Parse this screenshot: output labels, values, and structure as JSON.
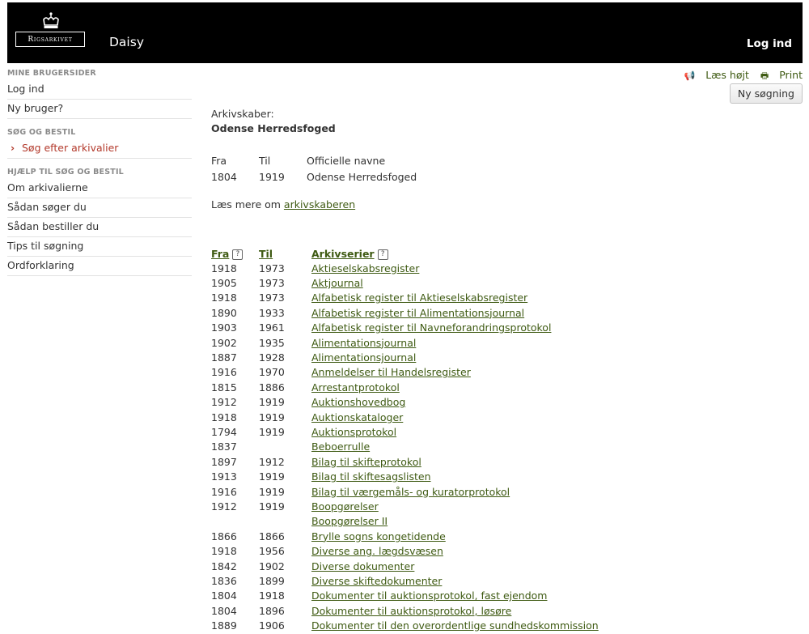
{
  "header": {
    "logo_text": "Rigsarkivet",
    "app_name": "Daisy",
    "login": "Log ind"
  },
  "sidebar": {
    "section1": "MINE BRUGERSIDER",
    "login": "Log ind",
    "new_user": "Ny bruger?",
    "section2": "SØG OG BESTIL",
    "search_active": "Søg efter arkivalier",
    "section3": "HJÆLP TIL SØG OG BESTIL",
    "help_items": [
      "Om arkivalierne",
      "Sådan søger du",
      "Sådan bestiller du",
      "Tips til søgning",
      "Ordforklaring"
    ]
  },
  "toolbar": {
    "read_aloud": "Læs højt",
    "print": "Print",
    "new_search": "Ny søgning"
  },
  "creator": {
    "label": "Arkivskaber:",
    "name": "Odense Herredsfoged",
    "col_from": "Fra",
    "col_to": "Til",
    "col_names": "Officielle navne",
    "from": "1804",
    "to": "1919",
    "official_name": "Odense Herredsfoged",
    "read_more_prefix": "Læs mere om ",
    "read_more_link": "arkivskaberen"
  },
  "series": {
    "col_from": "Fra",
    "col_to": "Til",
    "col_series": "Arkivserier",
    "help": "?",
    "rows": [
      {
        "from": "1918",
        "to": "1973",
        "name": "Aktieselskabsregister"
      },
      {
        "from": "1905",
        "to": "1973",
        "name": "Aktjournal"
      },
      {
        "from": "1918",
        "to": "1973",
        "name": "Alfabetisk register til Aktieselskabsregister"
      },
      {
        "from": "1890",
        "to": "1933",
        "name": "Alfabetisk register til Alimentationsjournal"
      },
      {
        "from": "1903",
        "to": "1961",
        "name": "Alfabetisk register til Navneforandringsprotokol"
      },
      {
        "from": "1902",
        "to": "1935",
        "name": "Alimentationsjournal"
      },
      {
        "from": "1887",
        "to": "1928",
        "name": "Alimentationsjournal"
      },
      {
        "from": "1916",
        "to": "1970",
        "name": "Anmeldelser til Handelsregister"
      },
      {
        "from": "1815",
        "to": "1886",
        "name": "Arrestantprotokol"
      },
      {
        "from": "1912",
        "to": "1919",
        "name": "Auktionshovedbog"
      },
      {
        "from": "1918",
        "to": "1919",
        "name": "Auktionskataloger"
      },
      {
        "from": "1794",
        "to": "1919",
        "name": "Auktionsprotokol"
      },
      {
        "from": "1837",
        "to": "",
        "name": "Beboerrulle"
      },
      {
        "from": "1897",
        "to": "1912",
        "name": "Bilag til skifteprotokol"
      },
      {
        "from": "1913",
        "to": "1919",
        "name": "Bilag til skiftesagslisten"
      },
      {
        "from": "1916",
        "to": "1919",
        "name": "Bilag til værgemåls- og kuratorprotokol"
      },
      {
        "from": "1912",
        "to": "1919",
        "name": "Boopgørelser"
      },
      {
        "from": "",
        "to": "",
        "name": "Boopgørelser II"
      },
      {
        "from": "1866",
        "to": "1866",
        "name": "Brylle sogns kongetidende"
      },
      {
        "from": "1918",
        "to": "1956",
        "name": "Diverse ang. lægdsvæsen"
      },
      {
        "from": "1842",
        "to": "1902",
        "name": "Diverse dokumenter"
      },
      {
        "from": "1836",
        "to": "1899",
        "name": "Diverse skiftedokumenter"
      },
      {
        "from": "1804",
        "to": "1918",
        "name": "Dokumenter til auktionsprotokol, fast ejendom"
      },
      {
        "from": "1804",
        "to": "1896",
        "name": "Dokumenter til auktionsprotokol, løsøre"
      },
      {
        "from": "1889",
        "to": "1906",
        "name": "Dokumenter til den overordentlige sundhedskommission"
      }
    ]
  }
}
